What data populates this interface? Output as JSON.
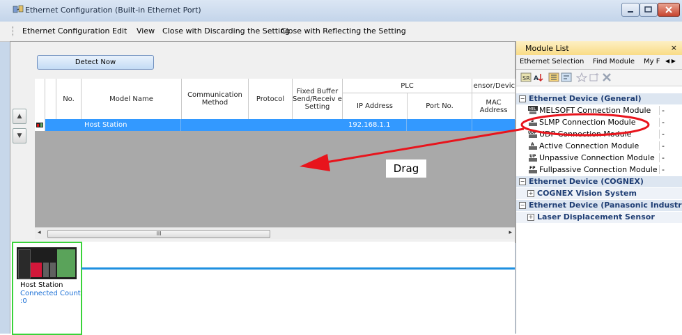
{
  "window": {
    "title": "Ethernet Configuration (Built-in Ethernet Port)"
  },
  "menu": [
    "Ethernet Configuration",
    "Edit",
    "View",
    "Close with Discarding the Setting",
    "Close with Reflecting the Setting"
  ],
  "toolbar": {
    "detect_label": "Detect Now"
  },
  "table": {
    "headers": {
      "no": "No.",
      "model_name": "Model Name",
      "comm_method": "Communication Method",
      "protocol": "Protocol",
      "fixed_buffer": "Fixed Buffer Send/Receiv e Setting",
      "plc": "PLC",
      "ip_address": "IP Address",
      "port_no": "Port No.",
      "sensor": "ensor/Devic",
      "mac": "MAC Address"
    },
    "rows": [
      {
        "model_name": "Host Station",
        "ip_address": "192.168.1.1"
      }
    ],
    "scroll_glyph": "III"
  },
  "host": {
    "label": "Host Station",
    "count_text": "Connected Count :0"
  },
  "module_list": {
    "title": "Module List",
    "close": "×",
    "tabs": [
      "Ethernet Selection",
      "Find Module",
      "My F"
    ],
    "tab_scroll": "◀ ▶",
    "categories": [
      {
        "label": "Ethernet Device (General)",
        "items": [
          {
            "label": "MELSOFT Connection Module",
            "icon": "MEL",
            "value": "-"
          },
          {
            "label": "SLMP Connection Module",
            "icon": "S",
            "value": "-"
          },
          {
            "label": "UDP Connection Module",
            "icon": "UDP",
            "value": "-"
          },
          {
            "label": "Active Connection Module",
            "icon": "A",
            "value": "-"
          },
          {
            "label": "Unpassive Connection Module",
            "icon": "UP",
            "value": "-"
          },
          {
            "label": "Fullpassive Connection Module",
            "icon": "FP",
            "value": "-"
          }
        ]
      },
      {
        "label": "Ethernet Device (COGNEX)",
        "sub": "COGNEX Vision System"
      },
      {
        "label": "Ethernet Device (Panasonic Industria",
        "sub": "Laser Displacement Sensor"
      }
    ]
  },
  "annotation": {
    "drag_text": "Drag",
    "color": "#e8141c"
  }
}
